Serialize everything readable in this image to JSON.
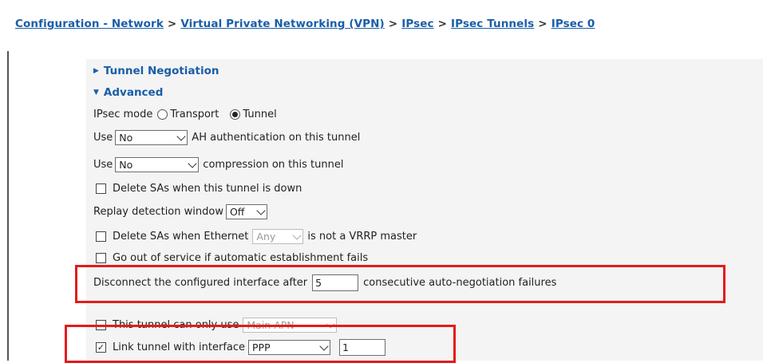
{
  "breadcrumb": [
    "Configuration - Network",
    "Virtual Private Networking (VPN)",
    "IPsec",
    "IPsec Tunnels",
    "IPsec 0"
  ],
  "breadcrumb_separator": ">",
  "sections": {
    "tunnel_negotiation": "Tunnel Negotiation",
    "advanced": "Advanced"
  },
  "ipsec_mode": {
    "label": "IPsec mode",
    "options": [
      "Transport",
      "Tunnel"
    ],
    "selected": "Tunnel"
  },
  "ah_auth": {
    "prefix": "Use",
    "value": "No",
    "suffix": "AH authentication on this tunnel"
  },
  "compression": {
    "prefix": "Use",
    "value": "No",
    "suffix": "compression on this tunnel"
  },
  "delete_sas_down": {
    "label": "Delete SAs when this tunnel is down",
    "checked": false
  },
  "replay": {
    "label": "Replay detection window",
    "value": "Off"
  },
  "delete_sas_ethernet": {
    "prefix": "Delete SAs when Ethernet",
    "value": "Any",
    "suffix": "is not a VRRP master",
    "checked": false
  },
  "out_of_service": {
    "label": "Go out of service if automatic establishment fails",
    "checked": false
  },
  "disconnect": {
    "prefix": "Disconnect the configured interface after",
    "value": "5",
    "suffix": "consecutive auto-negotiation failures"
  },
  "apn": {
    "label": "This tunnel can only use",
    "value": "Main APN",
    "checked": false
  },
  "link_tunnel": {
    "label": "Link tunnel with interface",
    "interface": "PPP",
    "instance": "1",
    "checked": true
  },
  "colors": {
    "link": "#1a5ea8",
    "highlight": "#e31b1b",
    "panel": "#f4f4f4"
  }
}
